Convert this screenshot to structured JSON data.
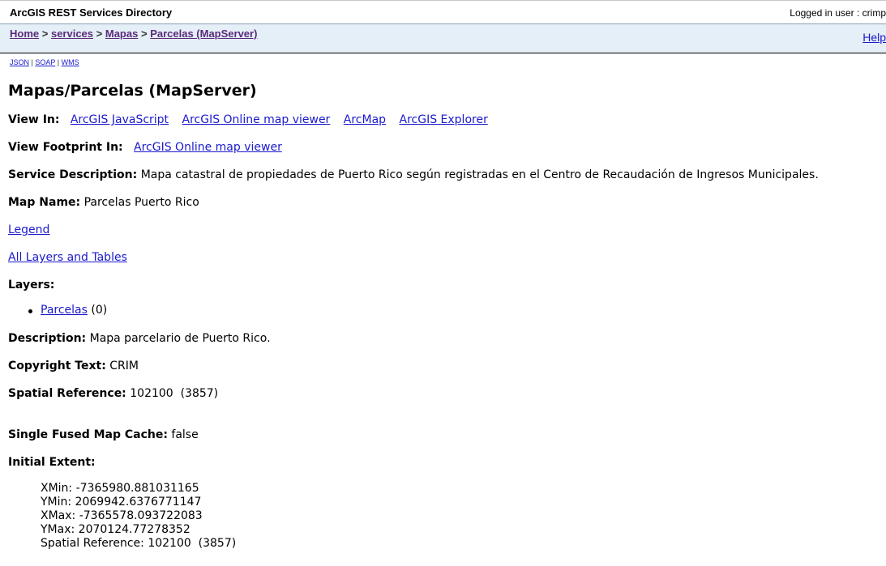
{
  "header": {
    "app_title": "ArcGIS REST Services Directory",
    "user_label": "Logged in user : crimp"
  },
  "nav": {
    "breadcrumb": [
      {
        "label": "Home"
      },
      {
        "label": "services"
      },
      {
        "label": "Mapas"
      },
      {
        "label": "Parcelas (MapServer)"
      }
    ],
    "separator": ">",
    "help": "Help"
  },
  "formats": {
    "items": [
      "JSON",
      "SOAP",
      "WMS"
    ],
    "separator": "|"
  },
  "page_title": "Mapas/Parcelas (MapServer)",
  "view_in": {
    "label": "View In:",
    "links": [
      "ArcGIS JavaScript",
      "ArcGIS Online map viewer",
      "ArcMap",
      "ArcGIS Explorer"
    ]
  },
  "view_footprint": {
    "label": "View Footprint In:",
    "link": "ArcGIS Online map viewer"
  },
  "service_description": {
    "label": "Service Description:",
    "value": "Mapa catastral de propiedades de Puerto Rico según registradas en el Centro de Recaudación de Ingresos Municipales."
  },
  "map_name": {
    "label": "Map Name:",
    "value": "Parcelas Puerto Rico"
  },
  "legend_link": "Legend",
  "all_layers_link": "All Layers and Tables",
  "layers": {
    "label": "Layers:",
    "items": [
      {
        "name": "Parcelas",
        "id": "(0)"
      }
    ]
  },
  "description": {
    "label": "Description:",
    "value": "Mapa parcelario de Puerto Rico."
  },
  "copyright": {
    "label": "Copyright Text:",
    "value": "CRIM"
  },
  "spatial_reference": {
    "label": "Spatial Reference:",
    "value": "102100  (3857)"
  },
  "single_fused": {
    "label": "Single Fused Map Cache:",
    "value": "false"
  },
  "initial_extent": {
    "label": "Initial Extent:",
    "lines": [
      "XMin: -7365980.881031165",
      "YMin: 2069942.6376771147",
      "XMax: -7365578.093722083",
      "YMax: 2070124.77278352",
      "Spatial Reference: 102100  (3857)"
    ]
  }
}
